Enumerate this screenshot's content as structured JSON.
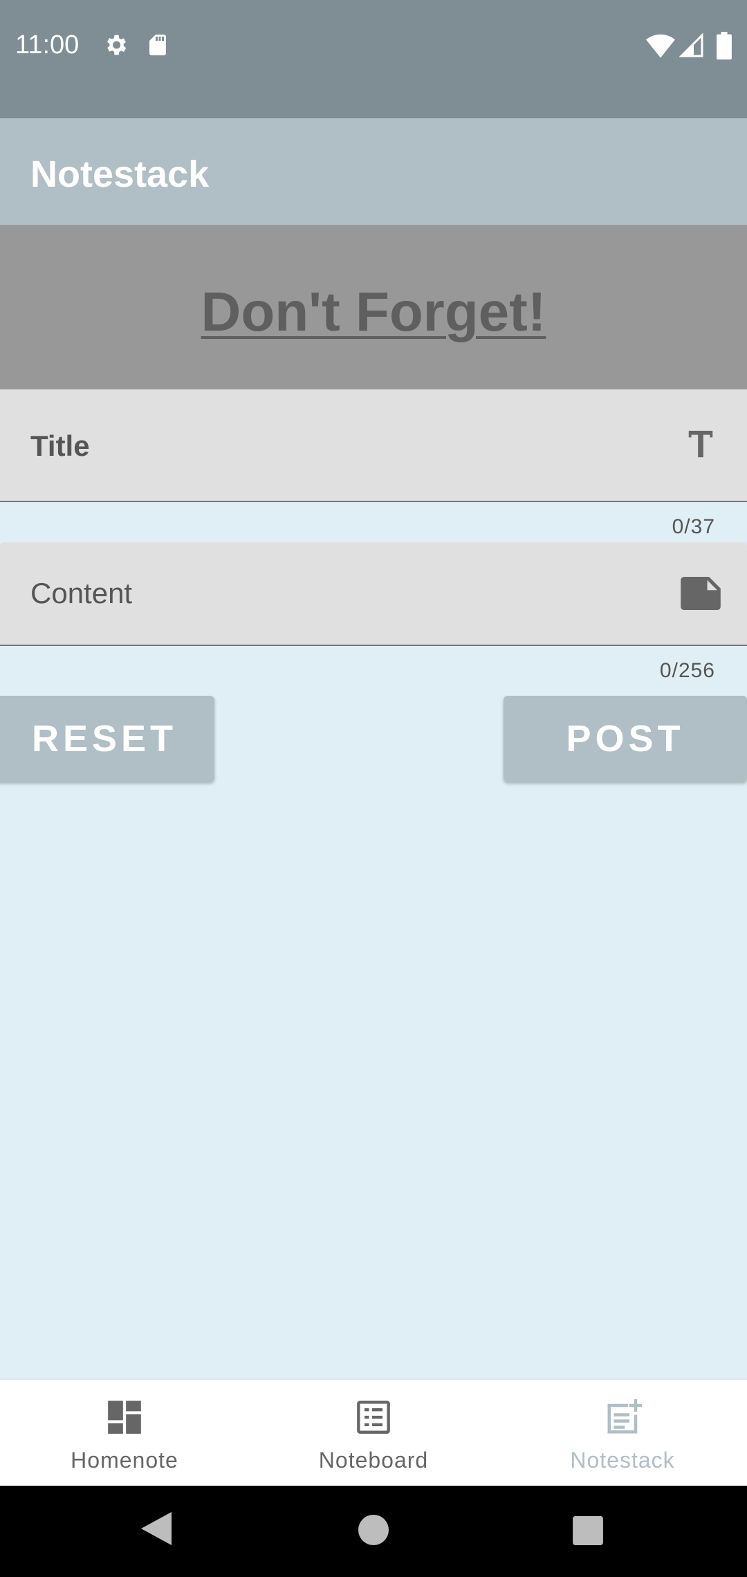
{
  "status_bar": {
    "time": "11:00",
    "left_icons": [
      "gear-icon",
      "sd-card-icon"
    ],
    "right_icons": [
      "wifi-icon",
      "cell-signal-icon",
      "battery-icon"
    ]
  },
  "app_bar": {
    "title": "Notestack"
  },
  "banner": {
    "text": "Don't Forget!"
  },
  "form": {
    "title_field": {
      "label": "Title",
      "counter": "0/37",
      "icon": "title-t-icon"
    },
    "content_field": {
      "label": "Content",
      "counter": "0/256",
      "icon": "note-icon"
    },
    "reset_label": "RESET",
    "post_label": "POST"
  },
  "bottom_nav": {
    "items": [
      {
        "label": "Homenote",
        "icon": "dashboard-icon",
        "active": false
      },
      {
        "label": "Noteboard",
        "icon": "list-board-icon",
        "active": false
      },
      {
        "label": "Notestack",
        "icon": "note-add-icon",
        "active": true
      }
    ]
  },
  "system_nav": [
    "back-icon",
    "home-icon",
    "recents-icon"
  ],
  "colors": {
    "status_bar": "#7f8d94",
    "app_bar": "#b0bec5",
    "banner": "#989898",
    "background": "#e0eff6",
    "field": "#e0e0e0"
  }
}
